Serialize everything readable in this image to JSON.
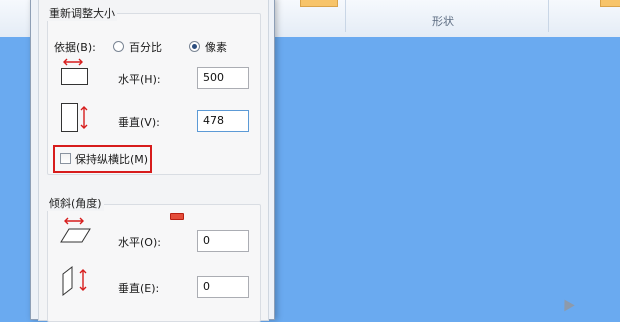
{
  "ribbon": {
    "group_label": "形状"
  },
  "dialog": {
    "resize_group": {
      "title": "重新调整大小",
      "basis_label": "依据(B):",
      "option_percent": "百分比",
      "option_pixels": "像素",
      "selected": "像素",
      "horizontal_label": "水平(H):",
      "horizontal_value": "500",
      "vertical_label": "垂直(V):",
      "vertical_value": "478",
      "keep_ratio_label": "保持纵横比(M)",
      "keep_ratio_checked": false
    },
    "skew_group": {
      "title": "倾斜(角度)",
      "horizontal_label": "水平(O):",
      "horizontal_value": "0",
      "vertical_label": "垂直(E):",
      "vertical_value": "0"
    }
  },
  "colors": {
    "canvas": "#6aaaf0",
    "highlight": "#d71c1c",
    "arrow": "#d71c1c"
  }
}
